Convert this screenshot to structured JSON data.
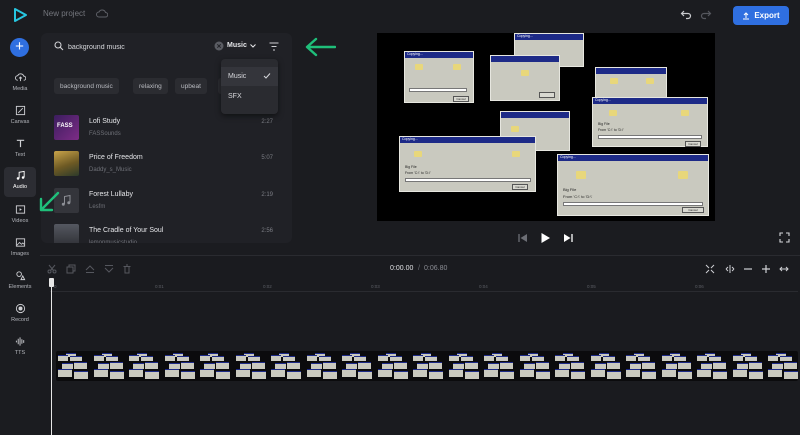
{
  "app": {
    "project_title": "New project",
    "export_label": "Export",
    "accent": "#2f6fe0"
  },
  "sidebar": {
    "items": [
      {
        "label": "Media",
        "icon": "cloud-upload-icon"
      },
      {
        "label": "Canvas",
        "icon": "canvas-icon"
      },
      {
        "label": "Text",
        "icon": "text-icon"
      },
      {
        "label": "Audio",
        "icon": "music-note-icon",
        "active": true
      },
      {
        "label": "Videos",
        "icon": "video-icon"
      },
      {
        "label": "Images",
        "icon": "image-icon"
      },
      {
        "label": "Elements",
        "icon": "shapes-icon"
      },
      {
        "label": "Record",
        "icon": "record-icon"
      },
      {
        "label": "TTS",
        "icon": "waveform-icon"
      }
    ]
  },
  "audio_panel": {
    "search_value": "background music",
    "type_selected": "Music",
    "chips": [
      "background music",
      "relaxing",
      "upbeat"
    ],
    "tracks": [
      {
        "title": "Lofi Study",
        "artist": "FASSounds",
        "duration": "2:27",
        "thumb_text": "FASS"
      },
      {
        "title": "Price of Freedom",
        "artist": "Daddy_s_Music",
        "duration": "5:07"
      },
      {
        "title": "Forest Lullaby",
        "artist": "Lesfm",
        "duration": "2:19"
      },
      {
        "title": "The Cradle of Your Soul",
        "artist": "lemonmusicstudio",
        "duration": "2:56"
      }
    ],
    "dropdown": {
      "options": [
        "Music",
        "SFX"
      ],
      "selected": "Music"
    }
  },
  "preview": {
    "dialog_title": "Copying...",
    "dialog_file": "Big File",
    "dialog_from": "From 'C:\\' to 'D:\\'",
    "dialog_cancel": "Cancel"
  },
  "timeline": {
    "current_time": "0:00.00",
    "separator": "/",
    "total_time": "0:06.80",
    "ticks": [
      "0",
      "0:01",
      "0:02",
      "0:03",
      "0:04",
      "0:05",
      "0:06"
    ]
  },
  "annotation_color": "#1fbf7a"
}
